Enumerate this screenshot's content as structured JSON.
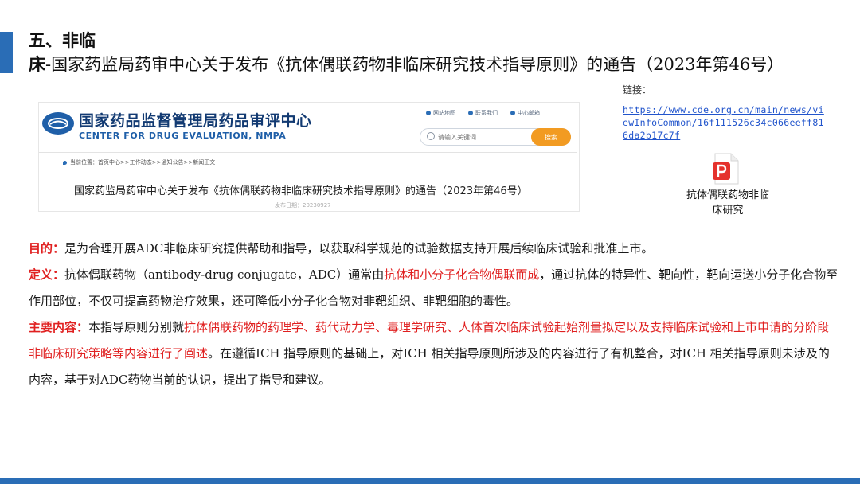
{
  "slide": {
    "title_bold": "五、非临床",
    "title_rest": "-国家药监局药审中心关于发布《抗体偶联药物非临床研究技术指导原则》的通告（2023年第46号）"
  },
  "site": {
    "name": "国家药品监督管理局药品审评中心",
    "name_en": "CENTER FOR DRUG EVALUATION, NMPA",
    "top_links": [
      "网站地图",
      "联系我们",
      "中心邮箱"
    ],
    "search_placeholder": "请输入关键词",
    "search_button": "搜索",
    "breadcrumb": "当前位置：首页中心>>工作动态>>通知公告>>新闻正文",
    "article_title": "国家药监局药审中心关于发布《抗体偶联药物非临床研究技术指导原则》的通告（2023年第46号）",
    "publish_date": "发布日期：20230927"
  },
  "link_panel": {
    "label": "链接：",
    "url": "https://www.cde.org.cn/main/news/viewInfoCommon/16f111526c34c066eeff816da2b17c7f",
    "file_icon": "pdf-icon",
    "file_name": "抗体偶联药物非临床研究"
  },
  "content": {
    "purpose_label": "目的：",
    "purpose_text": "是为合理开展ADC非临床研究提供帮助和指导，以获取科学规范的试验数据支持开展后续临床试验和批准上市。",
    "definition_label": "定义：",
    "definition_text_1": "抗体偶联药物（antibody-drug conjugate，ADC）通常由",
    "definition_highlight": "抗体和小分子化合物偶联而成",
    "definition_text_2": "，通过抗体的特异性、靶向性，靶向运送小分子化合物至作用部位，不仅可提高药物治疗效果，还可降低小分子化合物对非靶组织、非靶细胞的毒性。",
    "main_label": "主要内容：",
    "main_text_1": "本指导原则分别就",
    "main_highlight": "抗体偶联药物的药理学、药代动力学、毒理学研究、人体首次临床试验起始剂量拟定以及支持临床试验和上市申请的分阶段非临床研究策略等内容进行了阐述",
    "main_text_2": "。在遵循ICH 指导原则的基础上，对ICH 相关指导原则所涉及的内容进行了有机整合，对ICH 相关指导原则未涉及的内容，基于对ADC药物当前的认识，提出了指导和建议。"
  },
  "colors": {
    "accent": "#2a6db6",
    "highlight": "#e02020",
    "search_button": "#f29b22",
    "link": "#2255cc"
  }
}
